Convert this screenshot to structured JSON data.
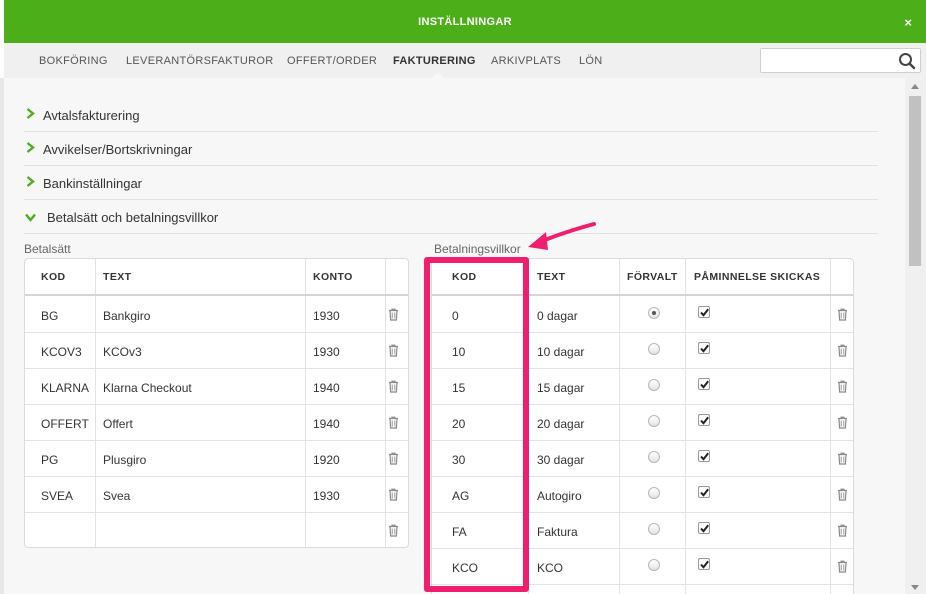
{
  "window": {
    "title": "INSTÄLLNINGAR",
    "close_symbol": "×"
  },
  "nav": {
    "tabs": [
      {
        "label": "BOKFÖRING",
        "active": false
      },
      {
        "label": "LEVERANTÖRSFAKTUROR",
        "active": false
      },
      {
        "label": "OFFERT/ORDER",
        "active": false
      },
      {
        "label": "FAKTURERING",
        "active": true
      },
      {
        "label": "ARKIVPLATS",
        "active": false
      },
      {
        "label": "LÖN",
        "active": false
      }
    ],
    "search": {
      "value": "",
      "placeholder": ""
    }
  },
  "sections": [
    {
      "label": "Avtalsfakturering",
      "expanded": false
    },
    {
      "label": "Avvikelser/Bortskrivningar",
      "expanded": false
    },
    {
      "label": "Bankinställningar",
      "expanded": false
    },
    {
      "label": "Betalsätt och betalningsvillkor",
      "expanded": true
    }
  ],
  "betalsatt": {
    "caption": "Betalsätt",
    "headers": [
      "KOD",
      "TEXT",
      "KONTO"
    ],
    "rows": [
      {
        "kod": "BG",
        "text": "Bankgiro",
        "konto": "1930"
      },
      {
        "kod": "KCOV3",
        "text": "KCOv3",
        "konto": "1930"
      },
      {
        "kod": "KLARNA",
        "text": "Klarna Checkout",
        "konto": "1940"
      },
      {
        "kod": "OFFERT",
        "text": "Offert",
        "konto": "1940"
      },
      {
        "kod": "PG",
        "text": "Plusgiro",
        "konto": "1920"
      },
      {
        "kod": "SVEA",
        "text": "Svea",
        "konto": "1930"
      },
      {
        "kod": "",
        "text": "",
        "konto": ""
      }
    ]
  },
  "villkor": {
    "caption": "Betalningsvillkor",
    "headers": [
      "KOD",
      "TEXT",
      "FÖRVALT",
      "PÅMINNELSE SKICKAS"
    ],
    "rows": [
      {
        "kod": "0",
        "text": "0 dagar",
        "forvalt": true,
        "paminnelse": true
      },
      {
        "kod": "10",
        "text": "10 dagar",
        "forvalt": false,
        "paminnelse": true
      },
      {
        "kod": "15",
        "text": "15 dagar",
        "forvalt": false,
        "paminnelse": true
      },
      {
        "kod": "20",
        "text": "20 dagar",
        "forvalt": false,
        "paminnelse": true
      },
      {
        "kod": "30",
        "text": "30 dagar",
        "forvalt": false,
        "paminnelse": true
      },
      {
        "kod": "AG",
        "text": "Autogiro",
        "forvalt": false,
        "paminnelse": true
      },
      {
        "kod": "FA",
        "text": "Faktura",
        "forvalt": false,
        "paminnelse": true
      },
      {
        "kod": "KCO",
        "text": "KCO",
        "forvalt": false,
        "paminnelse": true
      }
    ]
  },
  "colors": {
    "header_green": "#4caf1a",
    "highlight": "#ef1e6e",
    "chevron_green": "#4caf1a"
  }
}
